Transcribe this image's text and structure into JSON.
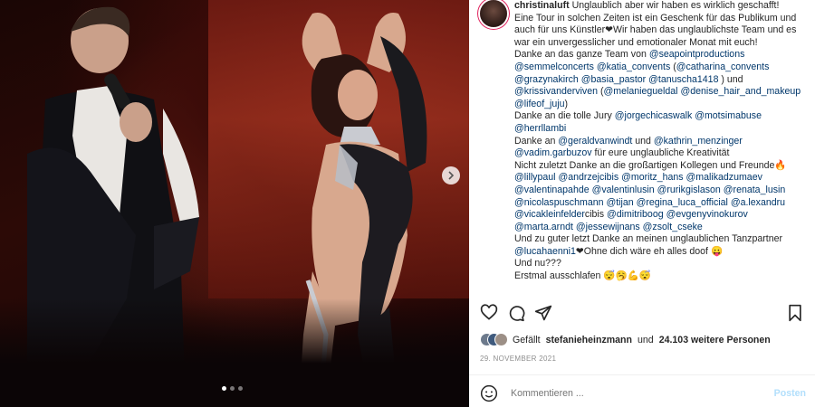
{
  "media": {
    "carousel_dots": 3,
    "active_dot": 0
  },
  "caption": {
    "username": "christinaluft",
    "lines": [
      "Unglaublich aber wir haben es wirklich geschafft! ",
      "Eine Tour in solchen Zeiten ist ein Geschenk für das Publikum und",
      "auch für uns Künstler❤Wir haben das unglaublichste Team und es",
      "war ein unvergesslicher und emotionaler Monat mit euch!",
      "Danke an das ganze Team von @seapointproductions",
      "@semmelconcerts @katia_convents (@catharina_convents",
      "@grazynakirch @basia_pastor @tanuscha1418 ) und",
      "@krissivanderviven (@melaniegueldal @denise_hair_and_makeup",
      "@lifeof_juju)",
      "Danke an die tolle Jury @jorgechicaswalk @motsimabuse",
      "@herrllambi",
      "Danke an @geraldvanwindt und @kathrin_menzinger",
      "@vadim.garbuzov für eure unglaubliche Kreativität",
      "Nicht zuletzt Danke an die großartigen Kollegen und Freunde🔥",
      "@lillypaul @andrzejcibis @moritz_hans @malikadzumaev",
      "@valentinapahde @valentinlusin @rurikgislason @renata_lusin",
      "@nicolaspuschmann @tijan @regina_luca_official @a.lexandru",
      "@vicakleinfelderсibis @dimitriboog @evgenyvinokurov",
      "@marta.arndt @jessewijnans @zsolt_cseke",
      "Und zu guter letzt Danke an meinen unglaublichen Tanzpartner",
      "@lucahaenni1❤Ohne dich wäre eh alles doof 😛",
      "Und nu???",
      "Erstmal ausschlafen 😴🥱💪😴"
    ]
  },
  "likes": {
    "prefix": "Gefällt",
    "user": "stefanieheinzmann",
    "middle": "und",
    "count": "24.103 weitere Personen"
  },
  "date": "29. NOVEMBER 2021",
  "comment": {
    "placeholder": "Kommentieren ...",
    "post_label": "Posten"
  },
  "colors": {
    "link": "#00376b",
    "post_disabled": "#b2dffc",
    "story_ring": "#e0245e"
  }
}
